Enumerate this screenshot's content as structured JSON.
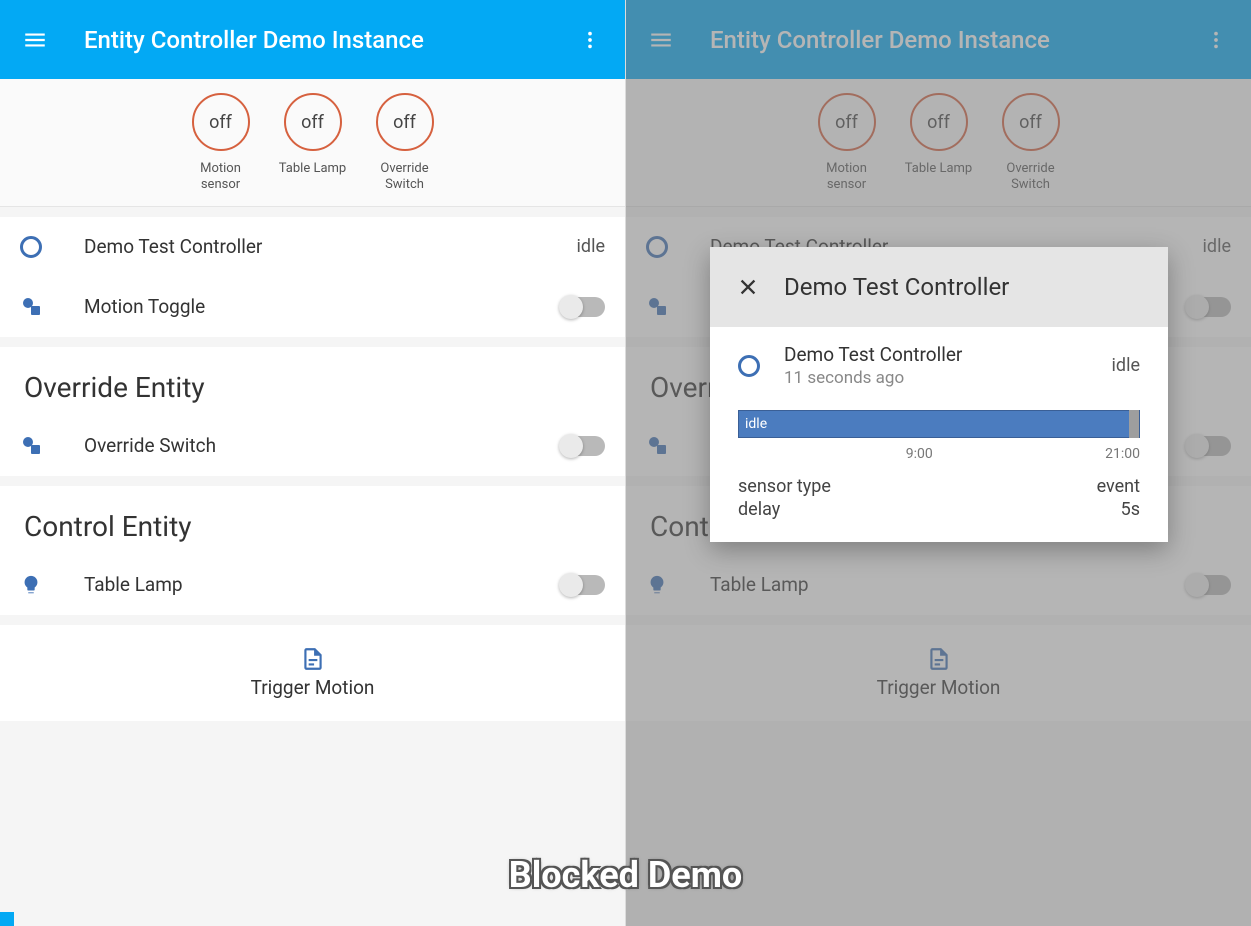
{
  "header": {
    "title": "Entity Controller Demo Instance"
  },
  "badges": [
    {
      "state": "off",
      "label": "Motion sensor"
    },
    {
      "state": "off",
      "label": "Table Lamp"
    },
    {
      "state": "off",
      "label": "Override Switch"
    }
  ],
  "status_card": {
    "controller": {
      "name": "Demo Test Controller",
      "state": "idle"
    },
    "motion_toggle": {
      "name": "Motion Toggle"
    }
  },
  "override_card": {
    "title": "Override Entity",
    "switch": {
      "name": "Override Switch"
    }
  },
  "control_card": {
    "title": "Control Entity",
    "lamp": {
      "name": "Table Lamp"
    }
  },
  "script": {
    "label": "Trigger Motion"
  },
  "dialog": {
    "title": "Demo Test Controller",
    "entity": {
      "name": "Demo Test Controller",
      "time": "11 seconds ago",
      "state": "idle"
    },
    "history": {
      "state_label": "idle",
      "tick1": "9:00",
      "tick2": "21:00"
    },
    "attrs": {
      "sensor_type_label": "sensor type",
      "sensor_type_value": "event",
      "delay_label": "delay",
      "delay_value": "5s"
    }
  },
  "caption": "Blocked Demo"
}
